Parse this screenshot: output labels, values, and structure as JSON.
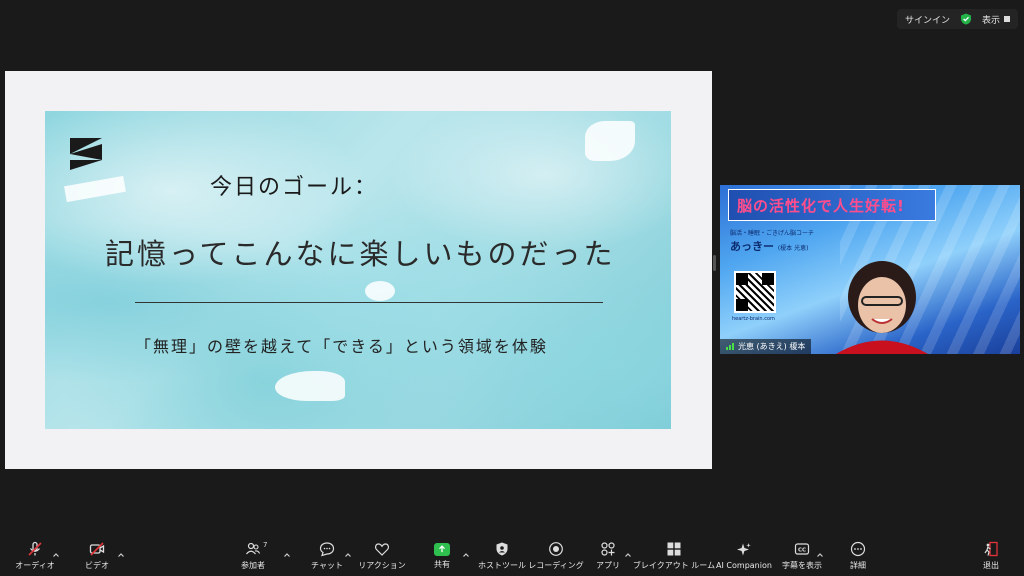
{
  "topbar": {
    "signin": "サインイン",
    "view": "表示"
  },
  "slide": {
    "subtitle": "今日のゴール：",
    "title": "記憶ってこんなに楽しいものだった",
    "description": "「無理」の壁を越えて「できる」という領域を体験"
  },
  "video": {
    "banner": "脳の活性化で人生好転!",
    "role": "脳活・睡眠・ごきげん脳コーチ",
    "nickname": "あっきー",
    "fullname_small": "(榎本 光恵)",
    "url": "heartz-brain.com",
    "participant_name": "光恵 (あきえ) 榎本"
  },
  "toolbar": {
    "audio": "オーディオ",
    "video": "ビデオ",
    "participants": "参加者",
    "participants_count": "7",
    "chat": "チャット",
    "reactions": "リアクション",
    "share": "共有",
    "host_tools": "ホストツール",
    "recording": "レコーディング",
    "apps": "アプリ",
    "breakout": "ブレイクアウト ルーム",
    "ai_companion": "AI Companion",
    "captions": "字幕を表示",
    "more": "詳細",
    "leave": "退出"
  },
  "colors": {
    "accent_green": "#2fbf4f",
    "muted_red": "#e0343b"
  }
}
